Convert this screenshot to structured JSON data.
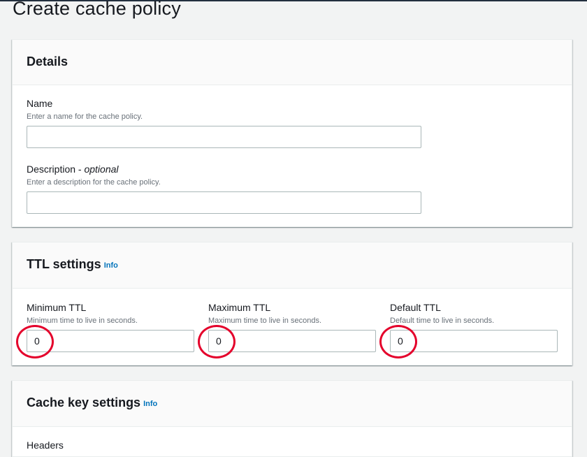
{
  "page": {
    "title": "Create cache policy"
  },
  "details": {
    "title": "Details",
    "name": {
      "label": "Name",
      "description": "Enter a name for the cache policy.",
      "value": ""
    },
    "description": {
      "label": "Description - ",
      "optional": "optional",
      "description": "Enter a description for the cache policy.",
      "value": ""
    }
  },
  "ttl": {
    "title": "TTL settings",
    "info": "Info",
    "minimum": {
      "label": "Minimum TTL",
      "description": "Minimum time to live in seconds.",
      "value": "0"
    },
    "maximum": {
      "label": "Maximum TTL",
      "description": "Maximum time to live in seconds.",
      "value": "0"
    },
    "default": {
      "label": "Default TTL",
      "description": "Default time to live in seconds.",
      "value": "0"
    }
  },
  "cache_key": {
    "title": "Cache key settings",
    "info": "Info",
    "headers_label": "Headers"
  },
  "colors": {
    "accent_link": "#0073bb",
    "annotation_circle": "#e4002b",
    "background": "#f2f3f3"
  }
}
